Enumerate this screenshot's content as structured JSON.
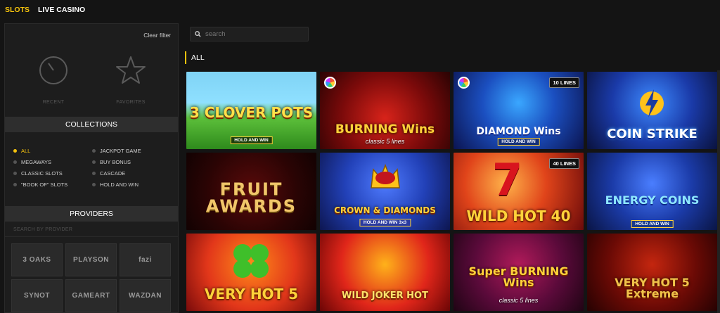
{
  "nav": {
    "tabs": [
      {
        "label": "SLOTS",
        "active": true
      },
      {
        "label": "LIVE CASINO",
        "active": false
      }
    ]
  },
  "sidebar": {
    "clear_filter": "Clear filter",
    "quick": {
      "recent": "RECENT",
      "favorites": "FAVORITES"
    },
    "collections_title": "COLLECTIONS",
    "collections": [
      {
        "label": "ALL",
        "active": true
      },
      {
        "label": "JACKPOT GAME",
        "active": false
      },
      {
        "label": "MEGAWAYS",
        "active": false
      },
      {
        "label": "BUY BONUS",
        "active": false
      },
      {
        "label": "CLASSIC SLOTS",
        "active": false
      },
      {
        "label": "CASCADE",
        "active": false
      },
      {
        "label": "\"BOOK OF\" SLOTS",
        "active": false
      },
      {
        "label": "HOLD AND WIN",
        "active": false
      }
    ],
    "providers_title": "PROVIDERS",
    "provider_search_placeholder": "SEARCH BY PROVIDER",
    "providers": [
      "3 OAKS",
      "PLAYSON",
      "fazi",
      "SYNOT",
      "GAMEART",
      "WAZDAN"
    ]
  },
  "main": {
    "search_placeholder": "search",
    "category": "ALL",
    "accent": "#f4c20d",
    "games": [
      {
        "title": "3 CLOVER POTS",
        "sub": "HOLD AND WIN"
      },
      {
        "title": "BURNING Wins",
        "sub": "classic 5 lines"
      },
      {
        "title": "DIAMOND Wins",
        "sub": "HOLD AND WIN",
        "badge": "10 LINES"
      },
      {
        "title": "COIN STRIKE",
        "sub": ""
      },
      {
        "title": "FRUIT AWARDS",
        "sub": ""
      },
      {
        "title": "CROWN & DIAMONDS",
        "sub": "HOLD AND WIN 3x3"
      },
      {
        "title": "WILD HOT 40",
        "sub": "",
        "badge": "40 LINES"
      },
      {
        "title": "ENERGY COINS",
        "sub": "HOLD AND WIN"
      },
      {
        "title": "VERY HOT 5",
        "sub": ""
      },
      {
        "title": "WILD JOKER HOT",
        "sub": ""
      },
      {
        "title": "Super BURNING Wins",
        "sub": "classic 5 lines"
      },
      {
        "title": "VERY HOT 5 Extreme",
        "sub": ""
      }
    ]
  }
}
